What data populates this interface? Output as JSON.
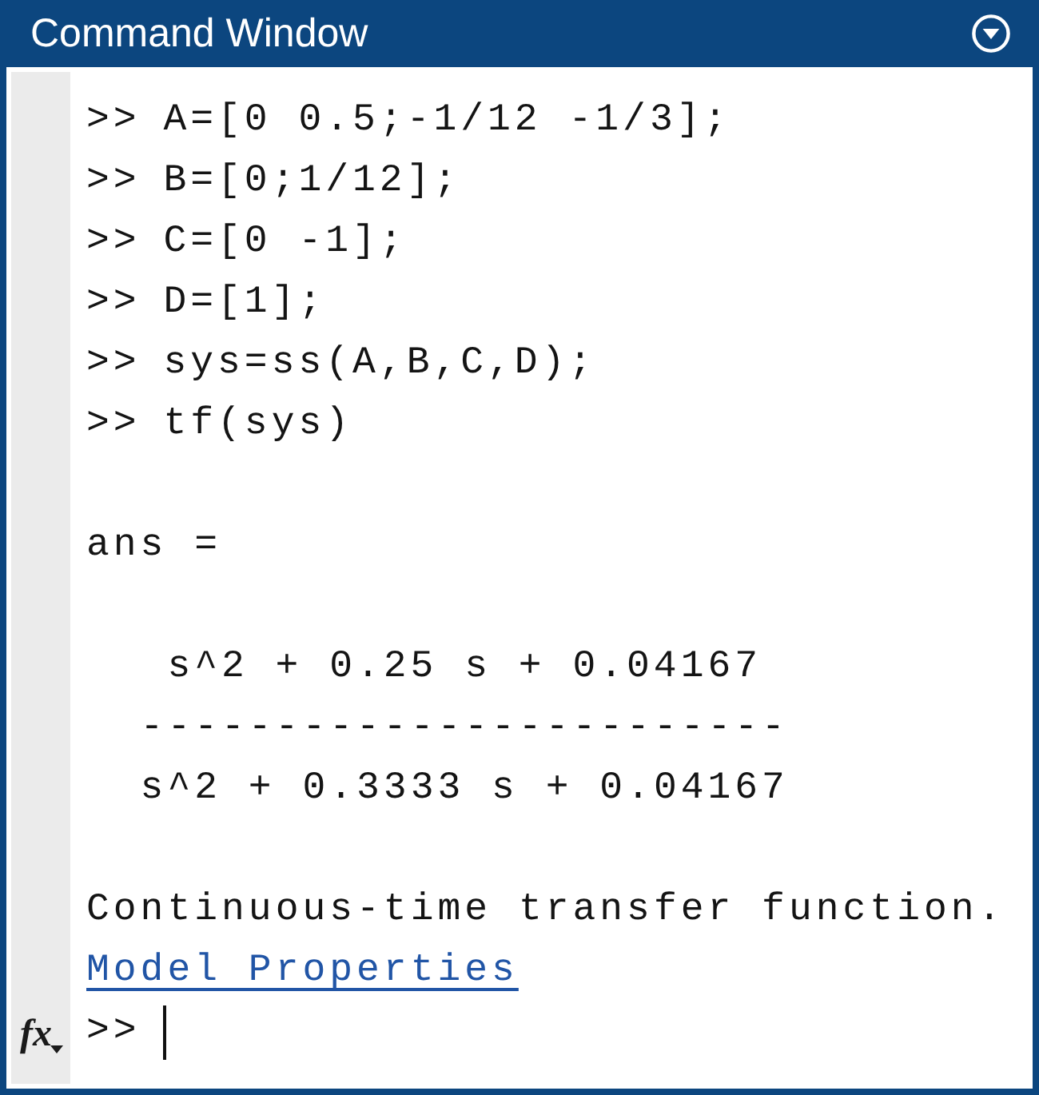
{
  "window": {
    "title": "Command Window"
  },
  "history": [
    {
      "prompt": ">>",
      "command": "A=[0 0.5;-1/12 -1/3];"
    },
    {
      "prompt": ">>",
      "command": "B=[0;1/12];"
    },
    {
      "prompt": ">>",
      "command": "C=[0 -1];"
    },
    {
      "prompt": ">>",
      "command": "D=[1];"
    },
    {
      "prompt": ">>",
      "command": "sys=ss(A,B,C,D);"
    },
    {
      "prompt": ">>",
      "command": "tf(sys)"
    }
  ],
  "output": {
    "variable": "ans =",
    "numerator": "s^2 + 0.25 s + 0.04167",
    "fraction_bar": "------------------------",
    "denominator": "s^2 + 0.3333 s + 0.04167",
    "description": "Continuous-time transfer function.",
    "link": "Model Properties"
  },
  "function_button": {
    "label": "fx"
  },
  "input": {
    "prompt": ">>"
  }
}
